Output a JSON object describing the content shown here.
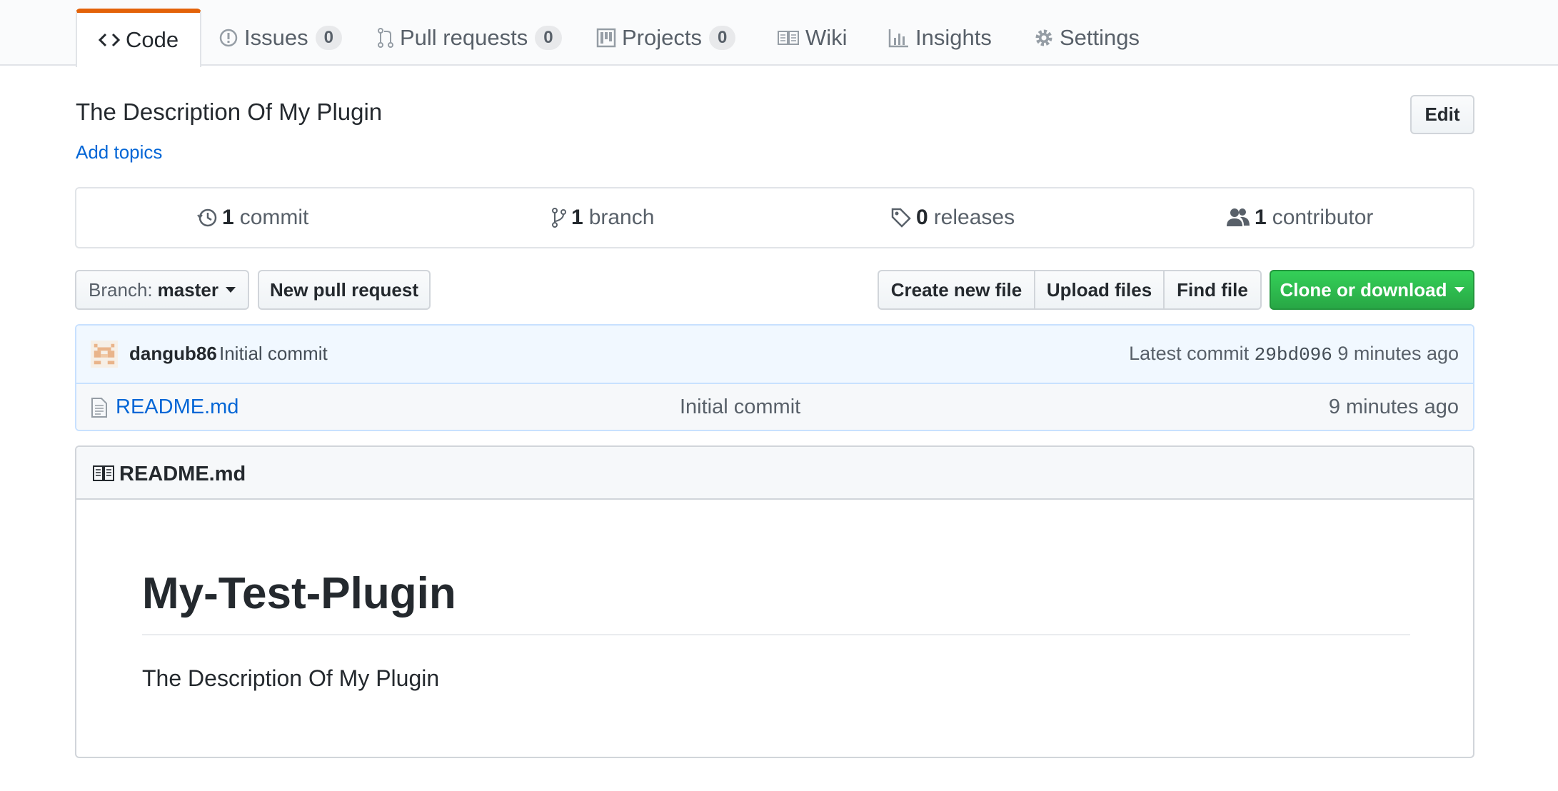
{
  "tabs": [
    {
      "label": "Code",
      "icon": "code-icon",
      "selected": true
    },
    {
      "label": "Issues",
      "icon": "issue-icon",
      "count": "0"
    },
    {
      "label": "Pull requests",
      "icon": "pull-request-icon",
      "count": "0"
    },
    {
      "label": "Projects",
      "icon": "project-icon",
      "count": "0"
    },
    {
      "label": "Wiki",
      "icon": "book-icon"
    },
    {
      "label": "Insights",
      "icon": "graph-icon"
    },
    {
      "label": "Settings",
      "icon": "gear-icon"
    }
  ],
  "repo": {
    "description": "The Description Of My Plugin",
    "add_topics": "Add topics",
    "edit_label": "Edit"
  },
  "summary": {
    "commits": {
      "count": "1",
      "label": "commit"
    },
    "branches": {
      "count": "1",
      "label": "branch"
    },
    "releases": {
      "count": "0",
      "label": "releases"
    },
    "contributors": {
      "count": "1",
      "label": "contributor"
    }
  },
  "toolbar": {
    "branch_prefix": "Branch:",
    "branch_name": "master",
    "new_pr": "New pull request",
    "create_file": "Create new file",
    "upload_files": "Upload files",
    "find_file": "Find file",
    "clone": "Clone or download"
  },
  "commit": {
    "author": "dangub86",
    "message": "Initial commit",
    "latest_prefix": "Latest commit",
    "sha": "29bd096",
    "age": "9 minutes ago"
  },
  "files": [
    {
      "name": "README.md",
      "message": "Initial commit",
      "age": "9 minutes ago"
    }
  ],
  "readme": {
    "title": "README.md",
    "h1": "My-Test-Plugin",
    "body": "The Description Of My Plugin"
  },
  "colors": {
    "accent": "#e36209",
    "link": "#0366d6",
    "primary_button": "#28a745"
  }
}
